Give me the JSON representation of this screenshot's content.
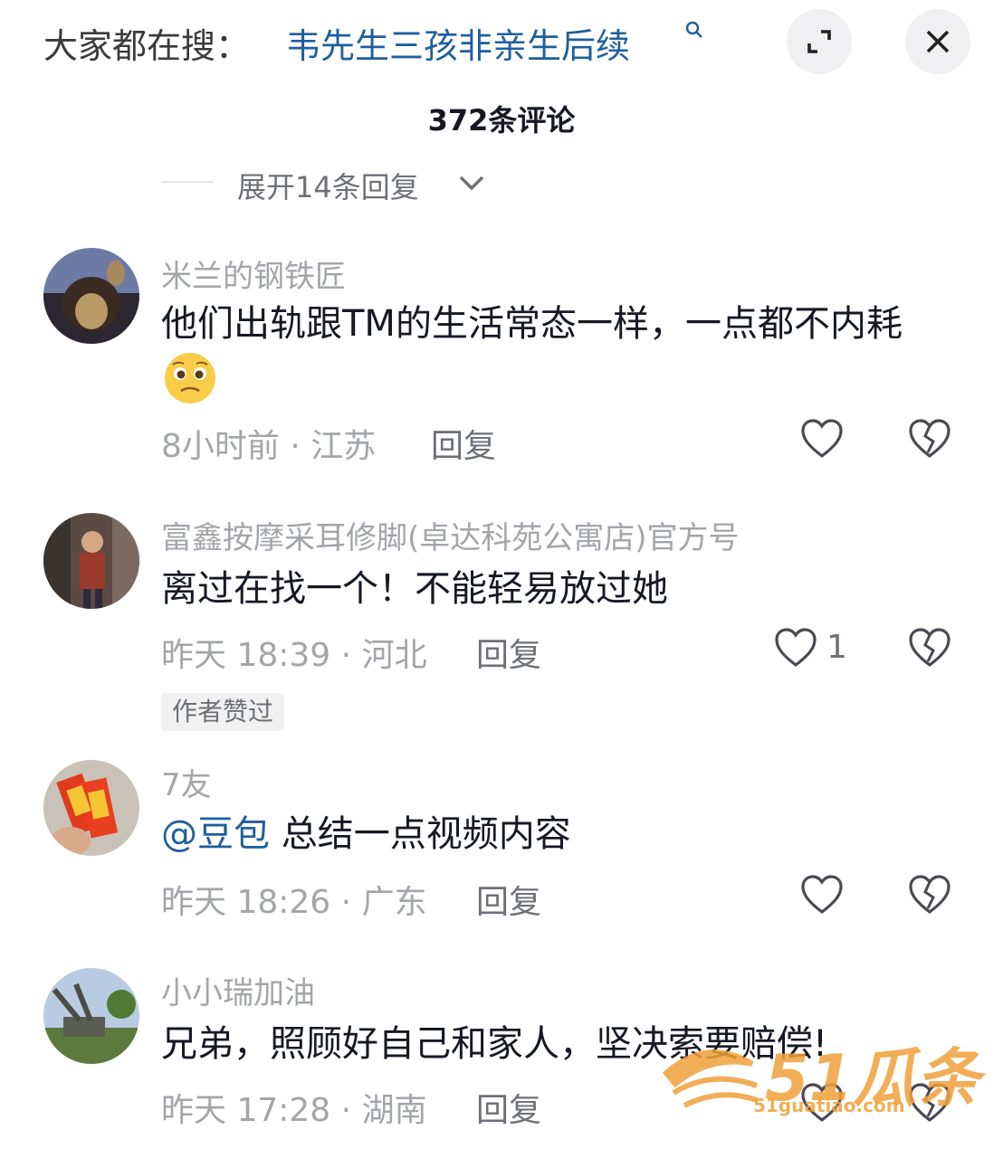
{
  "search_bar": {
    "prefix": "大家都在搜：",
    "term": "韦先生三孩非亲生后续",
    "search_icon": "search-icon"
  },
  "controls": {
    "expand_icon": "expand-icon",
    "close_icon": "close-icon"
  },
  "header": {
    "title": "372条评论"
  },
  "expand_replies": {
    "label": "展开14条回复",
    "icon": "chevron-down-icon"
  },
  "comments": [
    {
      "username": "米兰的钢铁匠",
      "text": "他们出轨跟TM的生活常态一样，一点都不内耗",
      "emoji": "pleading-face-emoji",
      "time": "8小时前",
      "separator": "·",
      "location": "江苏",
      "reply": "回复",
      "likes": "",
      "badge": ""
    },
    {
      "username": "富鑫按摩采耳修脚(卓达科苑公寓店)官方号",
      "text": "离过在找一个！不能轻易放过她",
      "time": "昨天 18:39",
      "separator": "·",
      "location": "河北",
      "reply": "回复",
      "likes": "1",
      "badge": "作者赞过"
    },
    {
      "username": "7友",
      "mention": "@豆包",
      "text": " 总结一点视频内容",
      "time": "昨天 18:26",
      "separator": "·",
      "location": "广东",
      "reply": "回复",
      "likes": "",
      "badge": ""
    },
    {
      "username": "小小瑞加油",
      "text": "兄弟，照顾好自己和家人，坚决索要赔偿!",
      "time": "昨天 17:28",
      "separator": "·",
      "location": "湖南",
      "reply": "回复",
      "likes": "",
      "badge": ""
    }
  ],
  "watermark": {
    "brand": "51瓜条",
    "url": "51guatiao.com"
  },
  "colors": {
    "link": "#1f5f9c",
    "muted": "#a4a5aa",
    "text": "#161823",
    "watermark": "#f0a13a"
  }
}
